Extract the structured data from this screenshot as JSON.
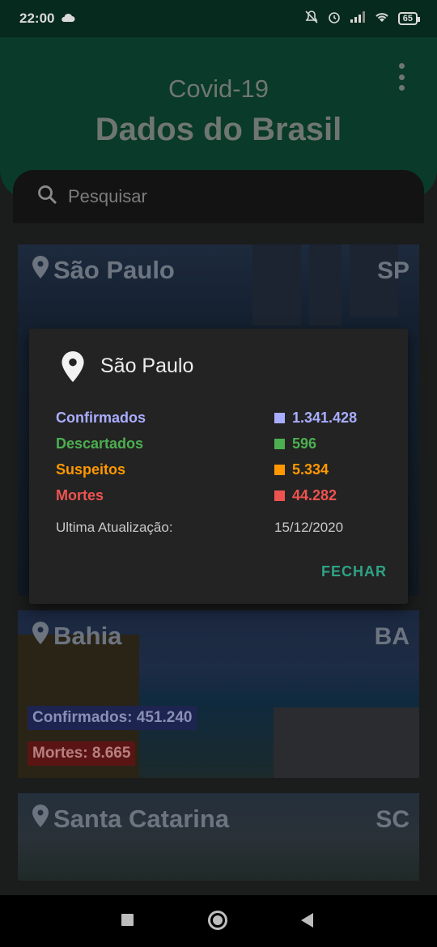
{
  "status_bar": {
    "time": "22:00",
    "battery": "65",
    "icons": [
      "cloud-icon",
      "bell-off-icon",
      "alarm-icon",
      "signal-icon",
      "wifi-icon",
      "battery-icon"
    ]
  },
  "header": {
    "title_small": "Covid-19",
    "title_large": "Dados do Brasil"
  },
  "search": {
    "placeholder": "Pesquisar"
  },
  "cards": [
    {
      "state": "São Paulo",
      "uf": "SP"
    },
    {
      "state": "Bahia",
      "uf": "BA",
      "confirmed": "Confirmados: 451.240",
      "deaths": "Mortes: 8.665"
    },
    {
      "state": "Santa Catarina",
      "uf": "SC"
    }
  ],
  "dialog": {
    "title": "São Paulo",
    "rows": [
      {
        "label": "Confirmados",
        "value": "1.341.428",
        "color": "#a9adff"
      },
      {
        "label": "Descartados",
        "value": "596",
        "color": "#4caf50"
      },
      {
        "label": "Suspeitos",
        "value": "5.334",
        "color": "#ff9800"
      },
      {
        "label": "Mortes",
        "value": "44.282",
        "color": "#ef5350"
      }
    ],
    "updated_label": "Ultima Atualização:",
    "updated_value": "15/12/2020",
    "close_label": "FECHAR"
  }
}
